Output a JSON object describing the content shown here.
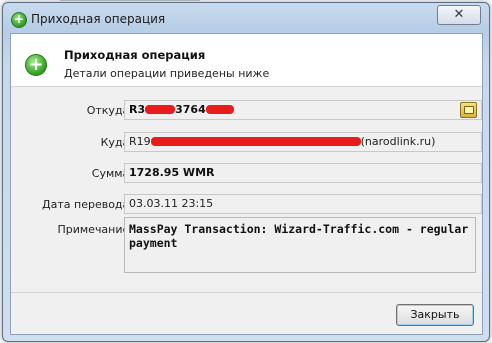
{
  "window": {
    "title": "Приходная операция",
    "close_glyph": "✕"
  },
  "header": {
    "title": "Приходная операция",
    "subtitle": "Детали операции приведены ниже"
  },
  "fields": {
    "from": {
      "label": "Откуда:",
      "prefix": "R3",
      "middle": "3764"
    },
    "to": {
      "label": "Куда:",
      "prefix": "R19",
      "suffix": "(narodlink.ru)"
    },
    "amount": {
      "label": "Сумма:",
      "value": "1728.95 WMR"
    },
    "date": {
      "label": "Дата перевода:",
      "value": "03.03.11 23:15"
    },
    "note": {
      "label": "Примечание:",
      "value": "MassPay Transaction: Wizard-Traffic.com - regular payment"
    }
  },
  "footer": {
    "close_label": "Закрыть"
  },
  "colors": {
    "redaction": "#e81c1c",
    "accent_green": "#34a324"
  }
}
